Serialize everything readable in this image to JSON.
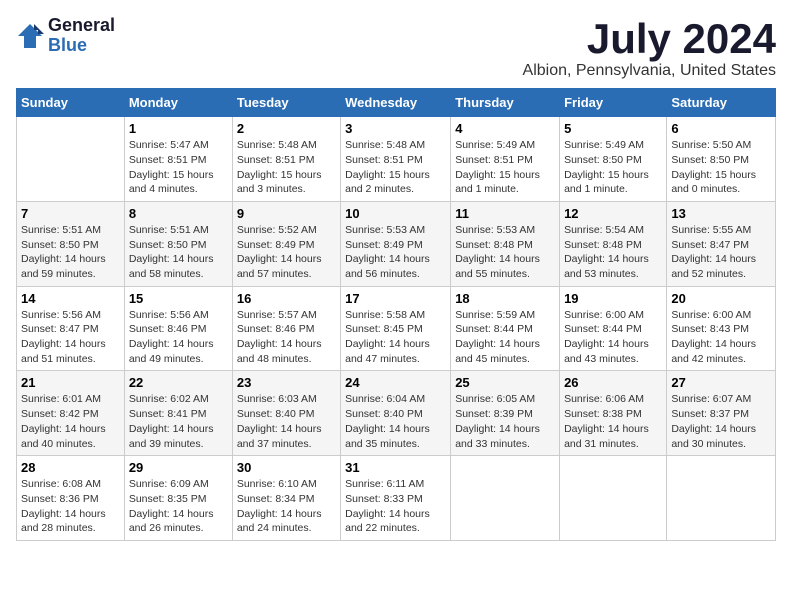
{
  "logo": {
    "general": "General",
    "blue": "Blue"
  },
  "title": "July 2024",
  "location": "Albion, Pennsylvania, United States",
  "days_of_week": [
    "Sunday",
    "Monday",
    "Tuesday",
    "Wednesday",
    "Thursday",
    "Friday",
    "Saturday"
  ],
  "weeks": [
    [
      {
        "day": "",
        "info": ""
      },
      {
        "day": "1",
        "info": "Sunrise: 5:47 AM\nSunset: 8:51 PM\nDaylight: 15 hours\nand 4 minutes."
      },
      {
        "day": "2",
        "info": "Sunrise: 5:48 AM\nSunset: 8:51 PM\nDaylight: 15 hours\nand 3 minutes."
      },
      {
        "day": "3",
        "info": "Sunrise: 5:48 AM\nSunset: 8:51 PM\nDaylight: 15 hours\nand 2 minutes."
      },
      {
        "day": "4",
        "info": "Sunrise: 5:49 AM\nSunset: 8:51 PM\nDaylight: 15 hours\nand 1 minute."
      },
      {
        "day": "5",
        "info": "Sunrise: 5:49 AM\nSunset: 8:50 PM\nDaylight: 15 hours\nand 1 minute."
      },
      {
        "day": "6",
        "info": "Sunrise: 5:50 AM\nSunset: 8:50 PM\nDaylight: 15 hours\nand 0 minutes."
      }
    ],
    [
      {
        "day": "7",
        "info": "Sunrise: 5:51 AM\nSunset: 8:50 PM\nDaylight: 14 hours\nand 59 minutes."
      },
      {
        "day": "8",
        "info": "Sunrise: 5:51 AM\nSunset: 8:50 PM\nDaylight: 14 hours\nand 58 minutes."
      },
      {
        "day": "9",
        "info": "Sunrise: 5:52 AM\nSunset: 8:49 PM\nDaylight: 14 hours\nand 57 minutes."
      },
      {
        "day": "10",
        "info": "Sunrise: 5:53 AM\nSunset: 8:49 PM\nDaylight: 14 hours\nand 56 minutes."
      },
      {
        "day": "11",
        "info": "Sunrise: 5:53 AM\nSunset: 8:48 PM\nDaylight: 14 hours\nand 55 minutes."
      },
      {
        "day": "12",
        "info": "Sunrise: 5:54 AM\nSunset: 8:48 PM\nDaylight: 14 hours\nand 53 minutes."
      },
      {
        "day": "13",
        "info": "Sunrise: 5:55 AM\nSunset: 8:47 PM\nDaylight: 14 hours\nand 52 minutes."
      }
    ],
    [
      {
        "day": "14",
        "info": "Sunrise: 5:56 AM\nSunset: 8:47 PM\nDaylight: 14 hours\nand 51 minutes."
      },
      {
        "day": "15",
        "info": "Sunrise: 5:56 AM\nSunset: 8:46 PM\nDaylight: 14 hours\nand 49 minutes."
      },
      {
        "day": "16",
        "info": "Sunrise: 5:57 AM\nSunset: 8:46 PM\nDaylight: 14 hours\nand 48 minutes."
      },
      {
        "day": "17",
        "info": "Sunrise: 5:58 AM\nSunset: 8:45 PM\nDaylight: 14 hours\nand 47 minutes."
      },
      {
        "day": "18",
        "info": "Sunrise: 5:59 AM\nSunset: 8:44 PM\nDaylight: 14 hours\nand 45 minutes."
      },
      {
        "day": "19",
        "info": "Sunrise: 6:00 AM\nSunset: 8:44 PM\nDaylight: 14 hours\nand 43 minutes."
      },
      {
        "day": "20",
        "info": "Sunrise: 6:00 AM\nSunset: 8:43 PM\nDaylight: 14 hours\nand 42 minutes."
      }
    ],
    [
      {
        "day": "21",
        "info": "Sunrise: 6:01 AM\nSunset: 8:42 PM\nDaylight: 14 hours\nand 40 minutes."
      },
      {
        "day": "22",
        "info": "Sunrise: 6:02 AM\nSunset: 8:41 PM\nDaylight: 14 hours\nand 39 minutes."
      },
      {
        "day": "23",
        "info": "Sunrise: 6:03 AM\nSunset: 8:40 PM\nDaylight: 14 hours\nand 37 minutes."
      },
      {
        "day": "24",
        "info": "Sunrise: 6:04 AM\nSunset: 8:40 PM\nDaylight: 14 hours\nand 35 minutes."
      },
      {
        "day": "25",
        "info": "Sunrise: 6:05 AM\nSunset: 8:39 PM\nDaylight: 14 hours\nand 33 minutes."
      },
      {
        "day": "26",
        "info": "Sunrise: 6:06 AM\nSunset: 8:38 PM\nDaylight: 14 hours\nand 31 minutes."
      },
      {
        "day": "27",
        "info": "Sunrise: 6:07 AM\nSunset: 8:37 PM\nDaylight: 14 hours\nand 30 minutes."
      }
    ],
    [
      {
        "day": "28",
        "info": "Sunrise: 6:08 AM\nSunset: 8:36 PM\nDaylight: 14 hours\nand 28 minutes."
      },
      {
        "day": "29",
        "info": "Sunrise: 6:09 AM\nSunset: 8:35 PM\nDaylight: 14 hours\nand 26 minutes."
      },
      {
        "day": "30",
        "info": "Sunrise: 6:10 AM\nSunset: 8:34 PM\nDaylight: 14 hours\nand 24 minutes."
      },
      {
        "day": "31",
        "info": "Sunrise: 6:11 AM\nSunset: 8:33 PM\nDaylight: 14 hours\nand 22 minutes."
      },
      {
        "day": "",
        "info": ""
      },
      {
        "day": "",
        "info": ""
      },
      {
        "day": "",
        "info": ""
      }
    ]
  ]
}
